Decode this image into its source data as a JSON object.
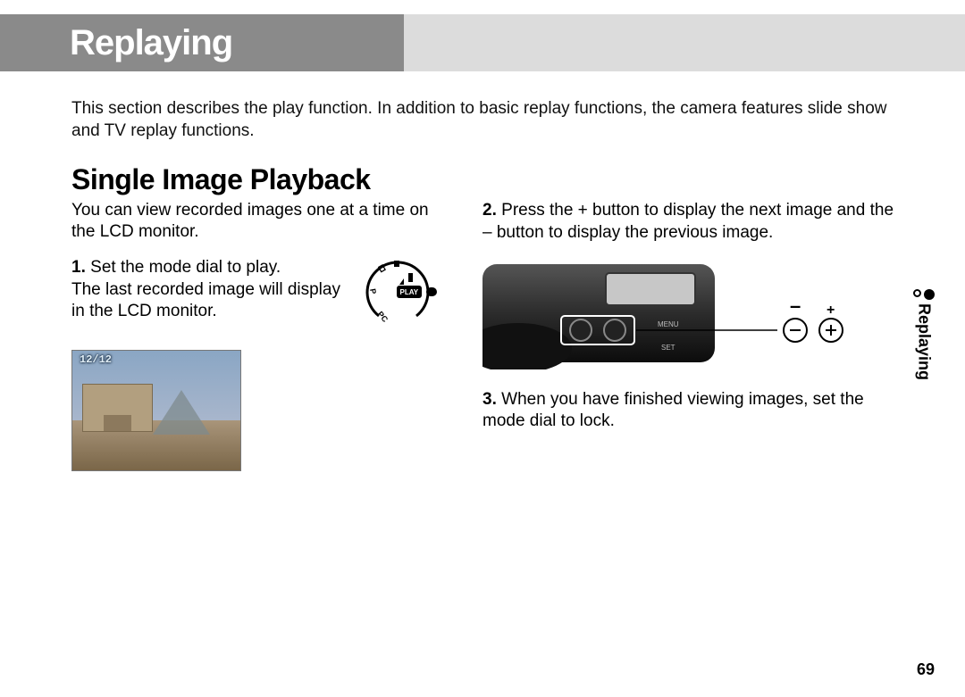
{
  "header": {
    "title": "Replaying"
  },
  "sideTab": {
    "label": "Replaying"
  },
  "intro": "This section describes the play function. In addition to basic replay functions, the camera features slide show and TV replay functions.",
  "section": {
    "title": "Single Image Playback",
    "subIntro": "You can view recorded images one at a time on the LCD monitor."
  },
  "step1": {
    "num": "1.",
    "text": "Set the mode dial to play.",
    "detail": "The last recorded image will display in the LCD monitor."
  },
  "dial": {
    "playLabel": "PLAY"
  },
  "lcd": {
    "counter": "12/12"
  },
  "step2": {
    "num": "2.",
    "text": "Press the + button to display the next image and the – button to display the previous image."
  },
  "buttons": {
    "minus": "–",
    "plus": "+"
  },
  "step3": {
    "num": "3.",
    "text": "When you have finished viewing images, set the mode dial to lock."
  },
  "pageNumber": "69"
}
